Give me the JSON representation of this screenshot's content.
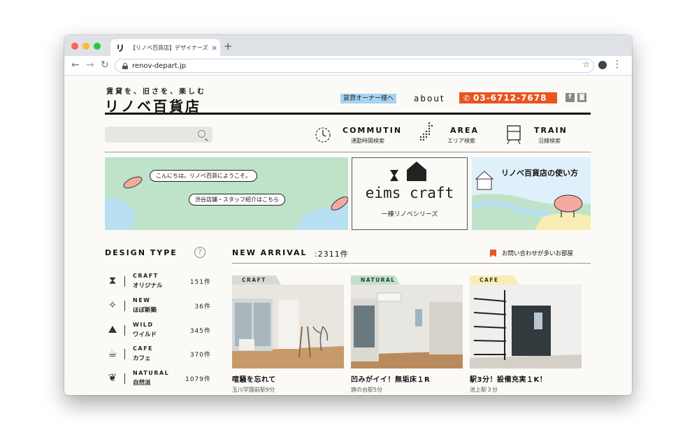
{
  "browser": {
    "tab_favicon": "リ",
    "tab_title": "【リノベ百貨店】デザイナーズ賃貸",
    "tab_close": "×",
    "new_tab": "+",
    "url": "renov-depart.jp",
    "back": "←",
    "forward": "→",
    "reload": "↻",
    "star": "☆",
    "menu": "⋮"
  },
  "header": {
    "tagline": "賃貸を、旧さを、楽しむ",
    "logo": "リノベ百貨店",
    "owner_link": "賃貸オーナー様へ",
    "about": "about",
    "phone": "03-6712-7678",
    "social": [
      "f",
      "◙"
    ]
  },
  "search": {
    "placeholder": ""
  },
  "nav": [
    {
      "title": "COMMUTIN",
      "sub": "通勤時間検索",
      "icon": "clock-icon"
    },
    {
      "title": "AREA",
      "sub": "エリア検索",
      "icon": "map-icon"
    },
    {
      "title": "TRAIN",
      "sub": "沿線検索",
      "icon": "train-icon"
    }
  ],
  "banners": {
    "greeting_1": "こんにちは。リノベ百貨にようこそ。",
    "greeting_2": "渋谷店舗・スタッフ紹介はこちら",
    "brand": "eims craft",
    "brand_sub": "一棟リノベシリーズ",
    "guide": "リノベ百貨店の使い方"
  },
  "design_type": {
    "title": "DESIGN TYPE",
    "help": "?",
    "items": [
      {
        "en": "CRAFT",
        "ja": "オリジナル",
        "count": "151件",
        "icon": "hourglass-icon",
        "glyph": "⧗"
      },
      {
        "en": "NEW",
        "ja": "ほぼ新築",
        "count": "36件",
        "icon": "sparkle-icon",
        "glyph": "✧"
      },
      {
        "en": "WILD",
        "ja": "ワイルド",
        "count": "345件",
        "icon": "mountain-icon",
        "glyph": "⛰"
      },
      {
        "en": "CAFE",
        "ja": "カフェ",
        "count": "370件",
        "icon": "cup-icon",
        "glyph": "☕"
      },
      {
        "en": "NATURAL",
        "ja": "自然派",
        "count": "1079件",
        "icon": "leaf-icon",
        "glyph": "❦"
      }
    ]
  },
  "new_arrival": {
    "title": "NEW ARRIVAL",
    "count": ":2311件",
    "inquiry": "お問い合わせが多いお部屋"
  },
  "cards": [
    {
      "tag": "CRAFT",
      "tag_color": "#d9d9d9",
      "title": "喧騒を忘れて",
      "station": "玉川学園前駅9分"
    },
    {
      "tag": "NATURAL",
      "tag_color": "#bfe3c8",
      "title": "凹みがイイ！無垢床１R",
      "station": "旗の台駅5分"
    },
    {
      "tag": "CAFE",
      "tag_color": "#f8edb4",
      "title": "駅3分！設備充実１K！",
      "station": "池上駅３分"
    }
  ],
  "colors": {
    "accent_orange": "#e8551f",
    "owner_blue": "#a7d4ef",
    "banner_green": "#bfe3c8"
  }
}
